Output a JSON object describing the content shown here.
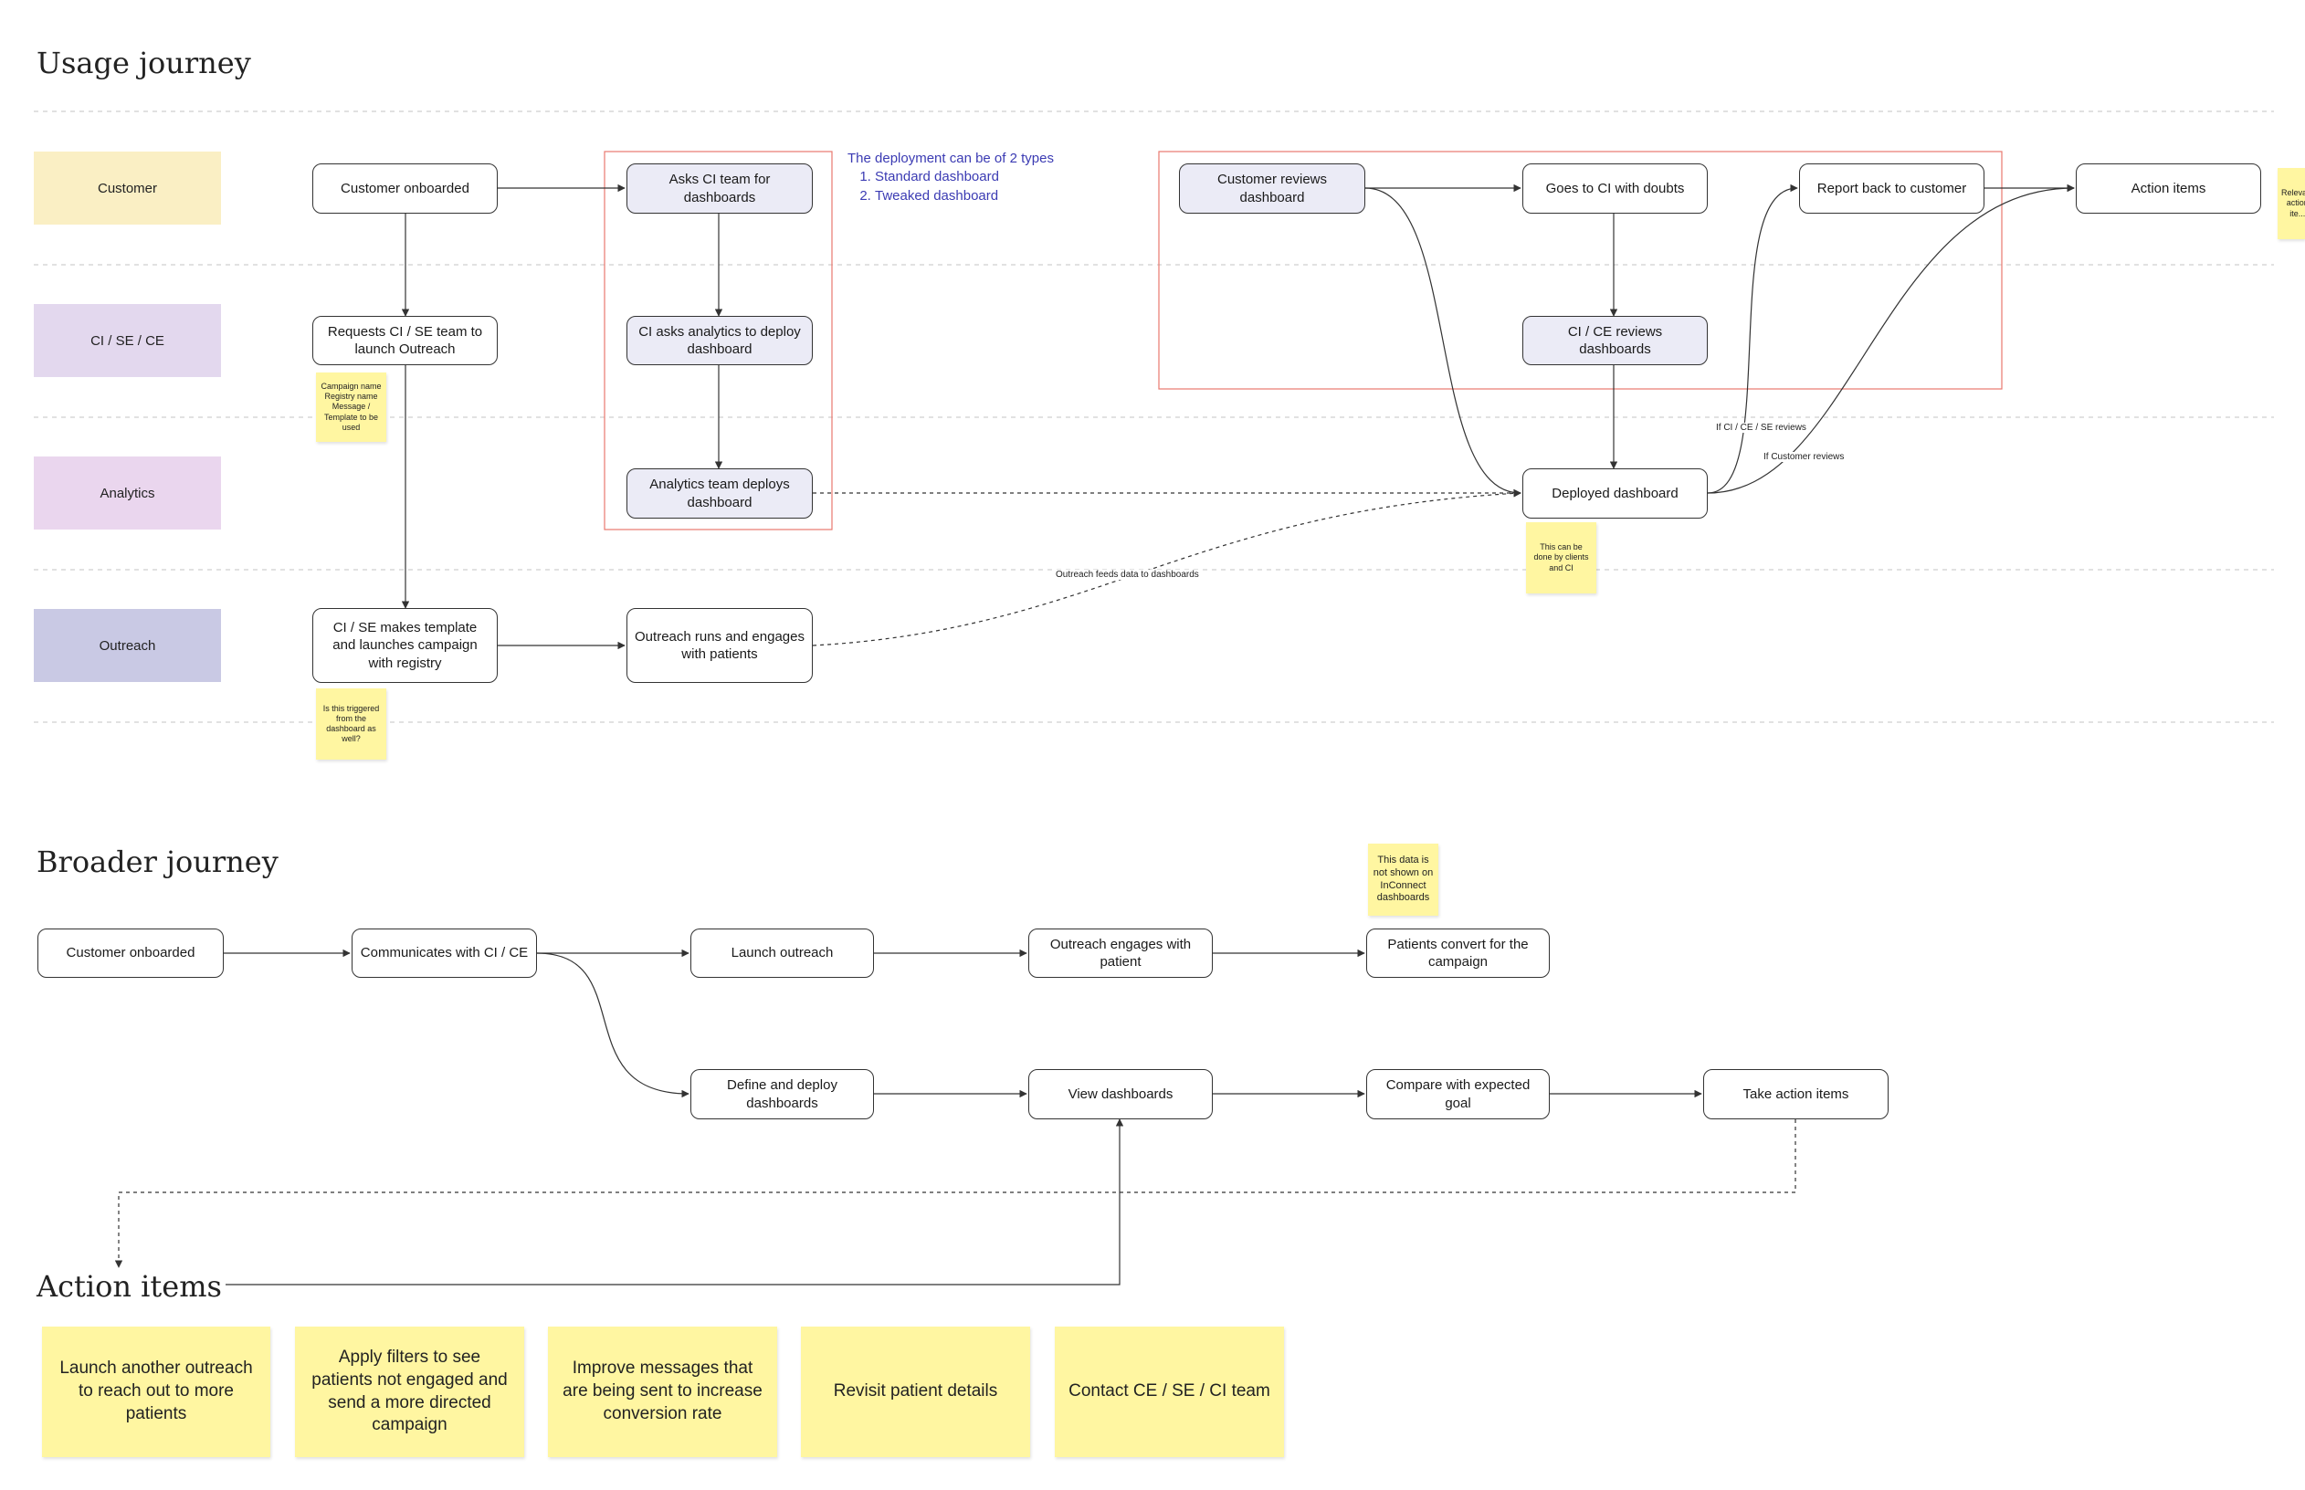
{
  "usage_journey": {
    "title": "Usage journey",
    "lanes": [
      "Customer",
      "CI / SE / CE",
      "Analytics",
      "Outreach"
    ],
    "nodes": {
      "customer_onboarded": "Customer onboarded",
      "asks_ci_team": "Asks CI team for dashboards",
      "requests_ci_se": "Requests CI / SE team to launch Outreach",
      "ci_asks_analytics": "CI asks analytics to deploy dashboard",
      "analytics_deploys": "Analytics team deploys dashboard",
      "ci_se_makes_template": "CI / SE makes template and launches campaign with registry",
      "outreach_runs": "Outreach runs and engages with patients",
      "customer_reviews": "Customer reviews dashboard",
      "goes_to_ci": "Goes to CI with doubts",
      "report_back": "Report back to customer",
      "action_items": "Action items",
      "ci_ce_reviews": "CI / CE reviews dashboards",
      "deployed_dashboard": "Deployed dashboard"
    },
    "deployment_note": {
      "heading": "The deployment can be of 2 types",
      "items": [
        "Standard dashboard",
        "Tweaked dashboard"
      ]
    },
    "edge_labels": {
      "outreach_feeds": "Outreach feeds data to dashboards",
      "if_ci_reviews": "If CI / CE / SE reviews",
      "if_customer_reviews": "If Customer reviews"
    },
    "stickies": {
      "campaign_info": "Campaign name Registry name Message / Template to be used",
      "triggered_question": "Is this triggered from the dashboard as well?",
      "done_by_clients": "This can be done by clients and CI",
      "relevant_actions": "Relevant action ite..."
    }
  },
  "broader_journey": {
    "title": "Broader journey",
    "nodes": {
      "customer_onboarded": "Customer onboarded",
      "communicates": "Communicates with CI / CE",
      "launch_outreach": "Launch outreach",
      "outreach_engages": "Outreach engages with patient",
      "patients_convert": "Patients convert for the campaign",
      "define_deploy": "Define and deploy dashboards",
      "view_dashboards": "View dashboards",
      "compare_goal": "Compare with expected goal",
      "take_action": "Take action items"
    },
    "sticky_not_shown": "This data is not shown on InConnect dashboards"
  },
  "action_items": {
    "title": "Action items",
    "items": [
      "Launch another outreach to reach out to more patients",
      "Apply filters to see patients not engaged and send a more directed campaign",
      "Improve messages that are being sent to increase conversion rate",
      "Revisit patient details",
      "Contact CE / SE / CI team"
    ]
  },
  "colors": {
    "lane_customer": "#faefc4",
    "lane_ci": "#e3d8ee",
    "lane_analytics": "#ead6ee",
    "lane_outreach": "#c9c9e4",
    "highlight_box": "#e8786e",
    "sticky": "#fff6a1",
    "note_text": "#3b3bb3"
  }
}
